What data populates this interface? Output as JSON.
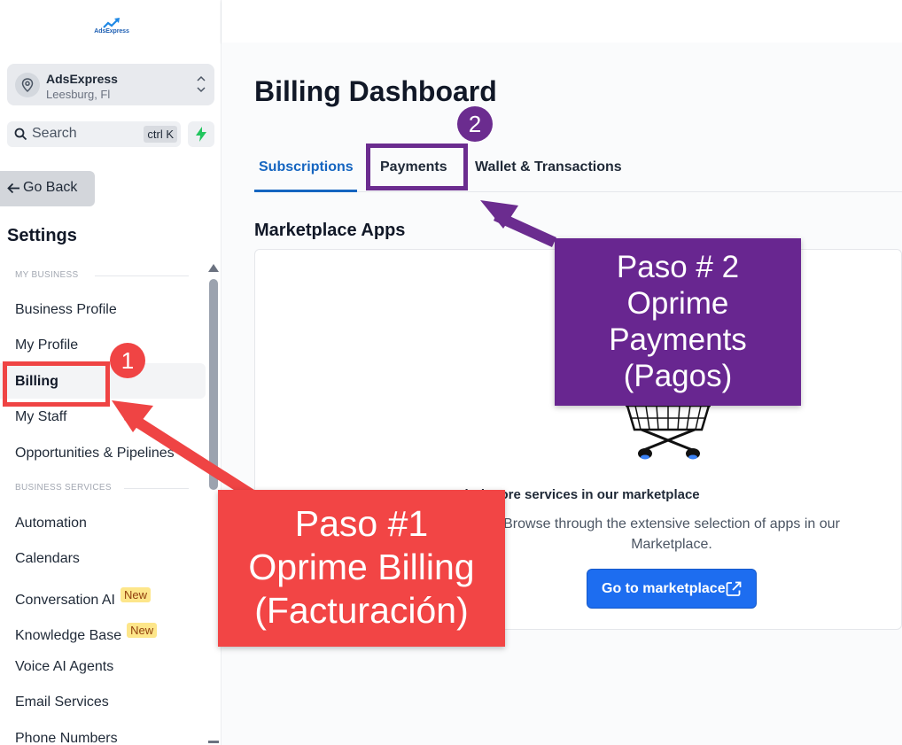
{
  "app": {
    "logo_text": "AdsExpress"
  },
  "account": {
    "name": "AdsExpress",
    "location": "Leesburg, Fl"
  },
  "search": {
    "label": "Search",
    "shortcut": "ctrl K"
  },
  "sidebar": {
    "go_back": "Go Back",
    "title": "Settings",
    "sections": [
      {
        "label": "MY BUSINESS",
        "items": [
          "Business Profile",
          "My Profile",
          "Billing",
          "My Staff",
          "Opportunities & Pipelines"
        ]
      },
      {
        "label": "BUSINESS SERVICES",
        "items": [
          "Automation",
          "Calendars",
          "Conversation AI",
          "Knowledge Base",
          "Voice AI Agents",
          "Email Services",
          "Phone Numbers"
        ]
      }
    ],
    "active_item": "Billing",
    "new_badge": "New"
  },
  "page": {
    "title": "Billing Dashboard",
    "tabs": [
      "Subscriptions",
      "Payments",
      "Wallet & Transactions"
    ],
    "active_tab": "Subscriptions",
    "section_title": "Marketplace Apps",
    "empty_title": "Find more services in our marketplace",
    "empty_text": "Browse through the extensive selection of apps in our Marketplace.",
    "cta": "Go to marketplace"
  },
  "annotations": {
    "step1_number": "1",
    "step2_number": "2",
    "step1_lines": [
      "Paso #1",
      "Oprime Billing",
      "(Facturación)"
    ],
    "step2_lines": [
      "Paso # 2",
      "Oprime",
      "Payments",
      "(Pagos)"
    ]
  },
  "colors": {
    "accent": "#1565c0",
    "cta": "#1d6df0",
    "step1": "#f24545",
    "step2": "#682690",
    "badge": "#fde68a"
  }
}
